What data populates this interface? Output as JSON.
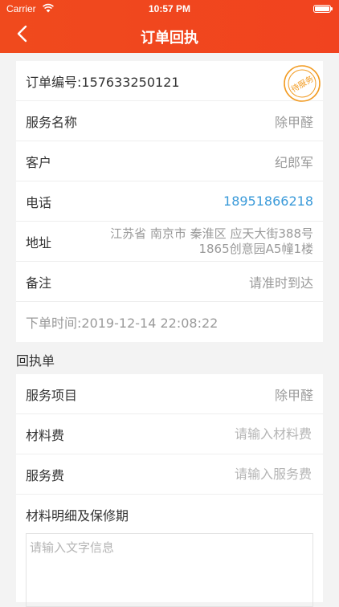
{
  "status_bar": {
    "carrier": "Carrier",
    "time": "10:57 PM"
  },
  "nav": {
    "title": "订单回执"
  },
  "order": {
    "number": "订单编号:157633250121",
    "stamp_text": "待服务",
    "service_name_label": "服务名称",
    "service_name_value": "除甲醛",
    "customer_label": "客户",
    "customer_value": "纪郎军",
    "phone_label": "电话",
    "phone_value": "18951866218",
    "address_label": "地址",
    "address_line1": "江苏省 南京市 秦淮区 应天大街388号",
    "address_line2": "1865创意园A5幢1楼",
    "note_label": "备注",
    "note_value": "请准时到达",
    "order_time": "下单时间:2019-12-14 22:08:22"
  },
  "receipt": {
    "section_title": "回执单",
    "service_item_label": "服务项目",
    "service_item_value": "除甲醛",
    "material_fee_label": "材料费",
    "material_fee_placeholder": "请输入材料费",
    "service_fee_label": "服务费",
    "service_fee_placeholder": "请输入服务费",
    "materials_detail_label": "材料明细及保修期",
    "materials_detail_placeholder": "请输入文字信息"
  },
  "colors": {
    "header": "#f1431f",
    "phone": "#3a9ad9",
    "stamp": "#f29b22"
  }
}
